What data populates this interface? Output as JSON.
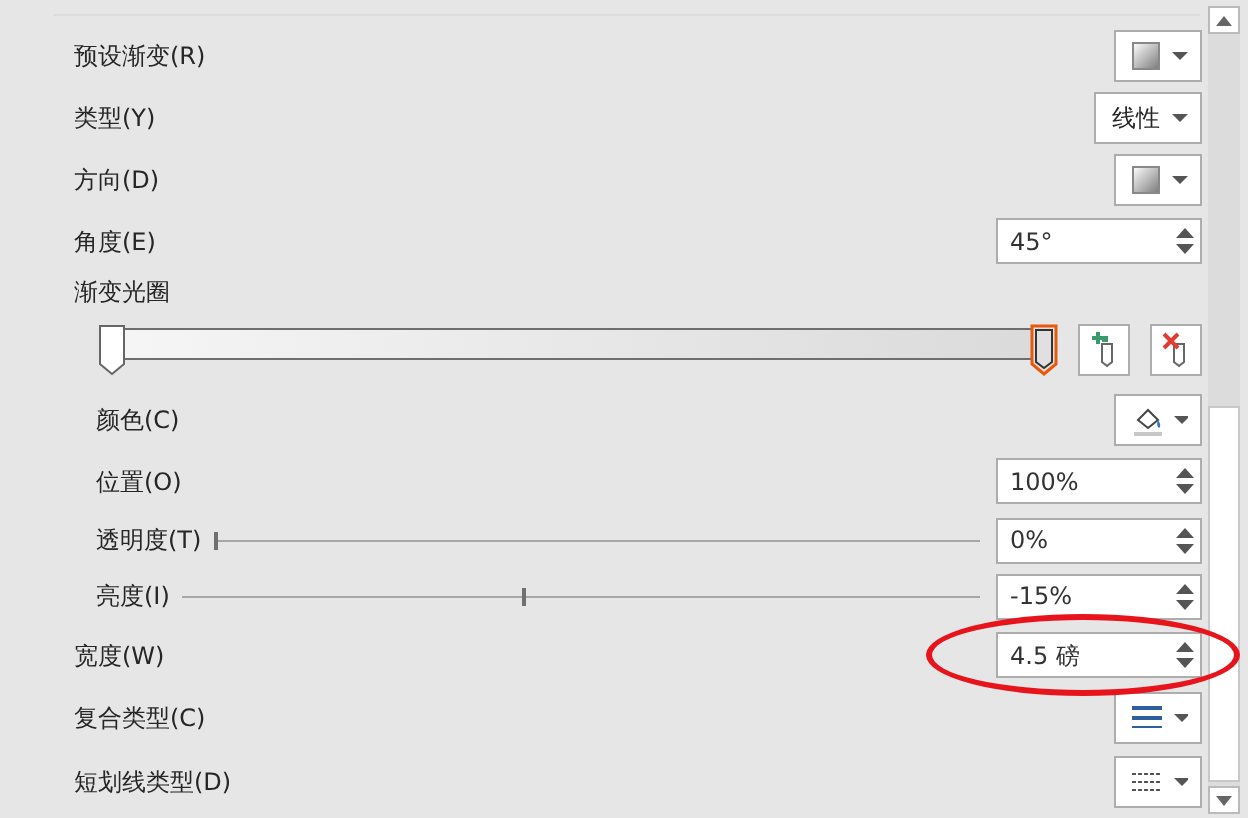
{
  "rows": [
    {
      "kind": "swatch-dropdown",
      "label": "预设渐变(R)"
    },
    {
      "kind": "text-dropdown",
      "label": "类型(Y)",
      "value": "线性"
    },
    {
      "kind": "swatch-dropdown",
      "label": "方向(D)"
    },
    {
      "kind": "spin",
      "label": "角度(E)",
      "value": "45°"
    },
    {
      "kind": "header",
      "label": "渐变光圈",
      "children": [
        {
          "kind": "gradient-bar",
          "stops": [
            {
              "level": 0,
              "selected": false
            },
            {
              "level": 1,
              "selected": true
            }
          ]
        },
        {
          "kind": "color-dropdown",
          "label": "颜色(C)"
        },
        {
          "kind": "spin",
          "label": "位置(O)",
          "value": "100%"
        },
        {
          "kind": "slider-spin",
          "label": "透明度(T)",
          "level": 0,
          "value": "0%"
        },
        {
          "kind": "slider-spin",
          "label": "亮度(I)",
          "level": 0.425,
          "value": "-15%"
        }
      ]
    },
    {
      "kind": "spin",
      "label": "宽度(W)",
      "value": "4.5 磅",
      "circled": true
    },
    {
      "kind": "lines-dropdown",
      "label": "复合类型(C)"
    },
    {
      "kind": "dash-dropdown",
      "label": "短划线类型(D)"
    }
  ]
}
